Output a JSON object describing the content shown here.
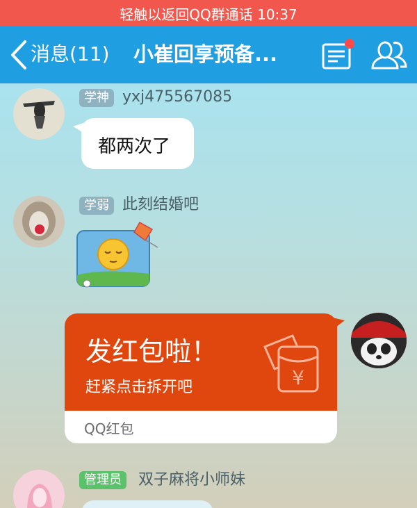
{
  "status_bar": {
    "call_text": "轻触以返回QQ群通话 10:37"
  },
  "nav": {
    "back_label": "消息(11)",
    "title": "小崔回享预备...",
    "notice_icon": "notice-board-icon",
    "group_icon": "group-members-icon"
  },
  "messages": [
    {
      "tag": "学神",
      "nick": "yxj475567085",
      "text": "都两次了"
    },
    {
      "tag": "学弱",
      "nick": "此刻结婚吧",
      "sticker": "sleeping-emoji-sticker"
    },
    {
      "red_packet": {
        "title": "发红包啦！",
        "subtitle": "赶紧点击拆开吧",
        "footer": "QQ红包",
        "currency_symbol": "¥"
      }
    },
    {
      "tag": "管理员",
      "nick": "双子麻将小师妹"
    }
  ],
  "colors": {
    "call_bar": "#f2574d",
    "nav": "#1f9ee1",
    "red_packet": "#e0470f",
    "tag_default": "#8fb2c0",
    "tag_admin": "#5cc16b"
  }
}
